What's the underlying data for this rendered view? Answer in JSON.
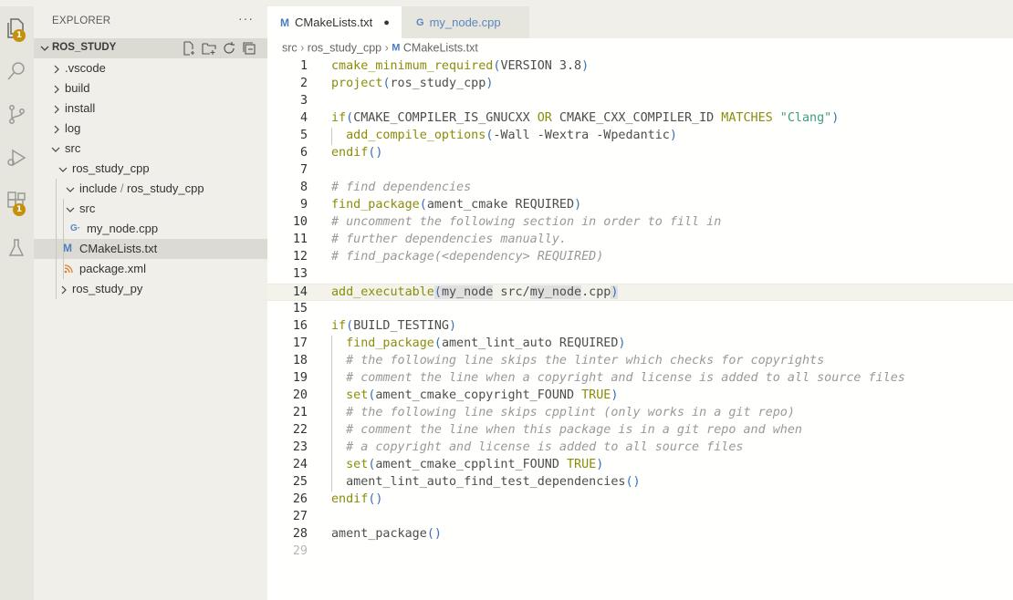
{
  "sidebar": {
    "title": "EXPLORER",
    "more": "···",
    "section": "ROS_STUDY",
    "tree": [
      {
        "label": ".vscode"
      },
      {
        "label": "build"
      },
      {
        "label": "install"
      },
      {
        "label": "log"
      },
      {
        "label": "src"
      },
      {
        "label": "ros_study_cpp"
      },
      {
        "label": "include",
        "label2": "ros_study_cpp"
      },
      {
        "label": "src"
      },
      {
        "label": "my_node.cpp"
      },
      {
        "label": "CMakeLists.txt"
      },
      {
        "label": "package.xml"
      },
      {
        "label": "ros_study_py"
      }
    ]
  },
  "activity": {
    "explorer_badge": "1",
    "extensions_badge": "1"
  },
  "tabs": [
    {
      "label": "CMakeLists.txt",
      "prefix": "M",
      "dirty": "●"
    },
    {
      "label": "my_node.cpp",
      "prefix": "G"
    }
  ],
  "breadcrumb": {
    "part1": "src",
    "part2": "ros_study_cpp",
    "file_prefix": "M",
    "file": "CMakeLists.txt"
  },
  "colors": {
    "keyword": "#8c8c0c",
    "string": "#3f9b84",
    "comment": "#999999",
    "paren": "#3b6fb6",
    "badge": "#c5900b"
  },
  "code": {
    "current_line": 14,
    "lines": [
      {
        "n": "1",
        "segs": [
          [
            "k",
            "cmake_minimum_required"
          ],
          [
            "p",
            "("
          ],
          [
            "t",
            "VERSION 3.8"
          ],
          [
            "p",
            ")"
          ]
        ]
      },
      {
        "n": "2",
        "segs": [
          [
            "k",
            "project"
          ],
          [
            "p",
            "("
          ],
          [
            "t",
            "ros_study_cpp"
          ],
          [
            "p",
            ")"
          ]
        ]
      },
      {
        "n": "3",
        "segs": []
      },
      {
        "n": "4",
        "segs": [
          [
            "k",
            "if"
          ],
          [
            "p",
            "("
          ],
          [
            "t",
            "CMAKE_COMPILER_IS_GNUCXX "
          ],
          [
            "k",
            "OR"
          ],
          [
            "t",
            " CMAKE_CXX_COMPILER_ID "
          ],
          [
            "k",
            "MATCHES"
          ],
          [
            "t",
            " "
          ],
          [
            "s",
            "\"Clang\""
          ],
          [
            "p",
            ")"
          ]
        ]
      },
      {
        "n": "5",
        "segs": [
          [
            "t",
            "  "
          ],
          [
            "k",
            "add_compile_options"
          ],
          [
            "p",
            "("
          ],
          [
            "t",
            "-Wall -Wextra -Wpedantic"
          ],
          [
            "p",
            ")"
          ]
        ]
      },
      {
        "n": "6",
        "segs": [
          [
            "k",
            "endif"
          ],
          [
            "p",
            "()"
          ]
        ]
      },
      {
        "n": "7",
        "segs": []
      },
      {
        "n": "8",
        "segs": [
          [
            "c",
            "# find dependencies"
          ]
        ]
      },
      {
        "n": "9",
        "segs": [
          [
            "k",
            "find_package"
          ],
          [
            "p",
            "("
          ],
          [
            "t",
            "ament_cmake REQUIRED"
          ],
          [
            "p",
            ")"
          ]
        ]
      },
      {
        "n": "10",
        "segs": [
          [
            "c",
            "# uncomment the following section in order to fill in"
          ]
        ]
      },
      {
        "n": "11",
        "segs": [
          [
            "c",
            "# further dependencies manually."
          ]
        ]
      },
      {
        "n": "12",
        "segs": [
          [
            "c",
            "# find_package(<dependency> REQUIRED)"
          ]
        ]
      },
      {
        "n": "13",
        "segs": []
      },
      {
        "n": "14",
        "segs": [
          [
            "k",
            "add_executable"
          ],
          [
            "ph",
            "("
          ],
          [
            "h",
            "my_node"
          ],
          [
            "t",
            " src/"
          ],
          [
            "h",
            "my_node"
          ],
          [
            "t",
            ".cpp"
          ],
          [
            "ph",
            ")"
          ]
        ]
      },
      {
        "n": "15",
        "segs": []
      },
      {
        "n": "16",
        "segs": [
          [
            "k",
            "if"
          ],
          [
            "p",
            "("
          ],
          [
            "t",
            "BUILD_TESTING"
          ],
          [
            "p",
            ")"
          ]
        ]
      },
      {
        "n": "17",
        "segs": [
          [
            "t",
            "  "
          ],
          [
            "k",
            "find_package"
          ],
          [
            "p",
            "("
          ],
          [
            "t",
            "ament_lint_auto REQUIRED"
          ],
          [
            "p",
            ")"
          ]
        ]
      },
      {
        "n": "18",
        "segs": [
          [
            "t",
            "  "
          ],
          [
            "c",
            "# the following line skips the linter which checks for copyrights"
          ]
        ]
      },
      {
        "n": "19",
        "segs": [
          [
            "t",
            "  "
          ],
          [
            "c",
            "# comment the line when a copyright and license is added to all source files"
          ]
        ]
      },
      {
        "n": "20",
        "segs": [
          [
            "t",
            "  "
          ],
          [
            "k",
            "set"
          ],
          [
            "p",
            "("
          ],
          [
            "t",
            "ament_cmake_copyright_FOUND "
          ],
          [
            "k",
            "TRUE"
          ],
          [
            "p",
            ")"
          ]
        ]
      },
      {
        "n": "21",
        "segs": [
          [
            "t",
            "  "
          ],
          [
            "c",
            "# the following line skips cpplint (only works in a git repo)"
          ]
        ]
      },
      {
        "n": "22",
        "segs": [
          [
            "t",
            "  "
          ],
          [
            "c",
            "# comment the line when this package is in a git repo and when"
          ]
        ]
      },
      {
        "n": "23",
        "segs": [
          [
            "t",
            "  "
          ],
          [
            "c",
            "# a copyright and license is added to all source files"
          ]
        ]
      },
      {
        "n": "24",
        "segs": [
          [
            "t",
            "  "
          ],
          [
            "k",
            "set"
          ],
          [
            "p",
            "("
          ],
          [
            "t",
            "ament_cmake_cpplint_FOUND "
          ],
          [
            "k",
            "TRUE"
          ],
          [
            "p",
            ")"
          ]
        ]
      },
      {
        "n": "25",
        "segs": [
          [
            "t",
            "  "
          ],
          [
            "t",
            "ament_lint_auto_find_test_dependencies"
          ],
          [
            "p",
            "()"
          ]
        ]
      },
      {
        "n": "26",
        "segs": [
          [
            "k",
            "endif"
          ],
          [
            "p",
            "()"
          ]
        ]
      },
      {
        "n": "27",
        "segs": []
      },
      {
        "n": "28",
        "segs": [
          [
            "t",
            "ament_package"
          ],
          [
            "p",
            "()"
          ]
        ]
      },
      {
        "n": "29",
        "segs": [],
        "dim": true
      }
    ]
  }
}
